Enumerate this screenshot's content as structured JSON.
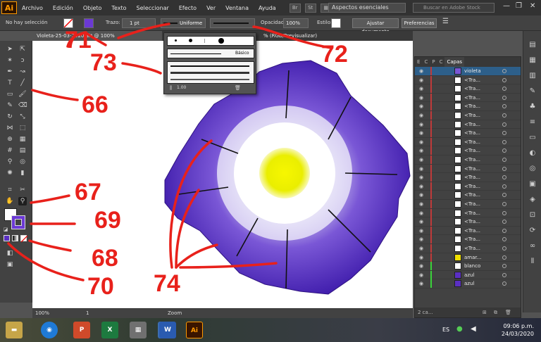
{
  "app": {
    "logo": "Ai",
    "menu": [
      "Archivo",
      "Edición",
      "Objeto",
      "Texto",
      "Seleccionar",
      "Efecto",
      "Ver",
      "Ventana",
      "Ayuda"
    ],
    "workspace": "Aspectos esenciales",
    "search_placeholder": "Buscar en Adobe Stock",
    "menu_icons": [
      "Br",
      "St"
    ]
  },
  "control_bar": {
    "selection": "No hay selección",
    "trazo_label": "Trazo:",
    "stroke_weight": "1 pt",
    "profile_label": "Uniforme",
    "opacity_label": "Opacidad:",
    "opacity_value": "100%",
    "style_label": "Estilo:",
    "fit_button": "Ajustar documento",
    "prefs_button": "Preferencias"
  },
  "tabs": {
    "doc1": "Violeta-25-03-2020.ai* @ 100% (RGB/Previsualizar)",
    "doc2": "% (RGB/Previsualizar)"
  },
  "stroke_popup": {
    "basic_label": "Básico",
    "size_value": "1.00"
  },
  "layers_panel": {
    "tabs": [
      "E",
      "C",
      "P",
      "C",
      "Capas"
    ],
    "active_tab": "Capas",
    "rows": [
      {
        "name": "violeta",
        "type": "layer"
      },
      {
        "name": "<Tra...",
        "type": "path"
      },
      {
        "name": "<Tra...",
        "type": "path"
      },
      {
        "name": "<Tra...",
        "type": "path"
      },
      {
        "name": "<Tra...",
        "type": "path"
      },
      {
        "name": "<Tra...",
        "type": "path"
      },
      {
        "name": "<Tra...",
        "type": "path"
      },
      {
        "name": "<Tra...",
        "type": "path"
      },
      {
        "name": "<Tra...",
        "type": "path"
      },
      {
        "name": "<Tra...",
        "type": "path"
      },
      {
        "name": "<Tra...",
        "type": "path"
      },
      {
        "name": "<Tra...",
        "type": "path"
      },
      {
        "name": "<Tra...",
        "type": "path"
      },
      {
        "name": "<Tra...",
        "type": "path"
      },
      {
        "name": "<Tra...",
        "type": "path"
      },
      {
        "name": "<Tra...",
        "type": "path"
      },
      {
        "name": "<Tra...",
        "type": "path"
      },
      {
        "name": "<Tra...",
        "type": "path"
      },
      {
        "name": "<Tra...",
        "type": "path"
      },
      {
        "name": "<Tra...",
        "type": "path"
      },
      {
        "name": "<Tra...",
        "type": "path"
      },
      {
        "name": "amar...",
        "type": "layer"
      },
      {
        "name": "blanco",
        "type": "layer"
      },
      {
        "name": "azul",
        "type": "path"
      },
      {
        "name": "azul",
        "type": "path"
      }
    ],
    "footer": "2 ca..."
  },
  "status_bar": {
    "zoom": "100%",
    "artboard": "1",
    "tool": "Zoom"
  },
  "taskbar": {
    "lang": "ES",
    "time": "09:06 p.m.",
    "date": "24/03/2020",
    "apps": [
      "explorer",
      "chrome",
      "powerpoint",
      "excel",
      "calculator",
      "photos",
      "word",
      "illustrator"
    ]
  },
  "annotations": {
    "n66": "66",
    "n67": "67",
    "n68": "68",
    "n69": "69",
    "n70": "70",
    "n71": "71",
    "n72": "72",
    "n73": "73",
    "n74": "74"
  },
  "colors": {
    "accent_red": "#e8211b",
    "petal_purple": "#4a22b8",
    "flower_center": "#f2f200",
    "layer_violet_bar": "#c03a3a",
    "layer_green_bar": "#3ad33a",
    "illustrator_orange": "#ff9a00"
  }
}
